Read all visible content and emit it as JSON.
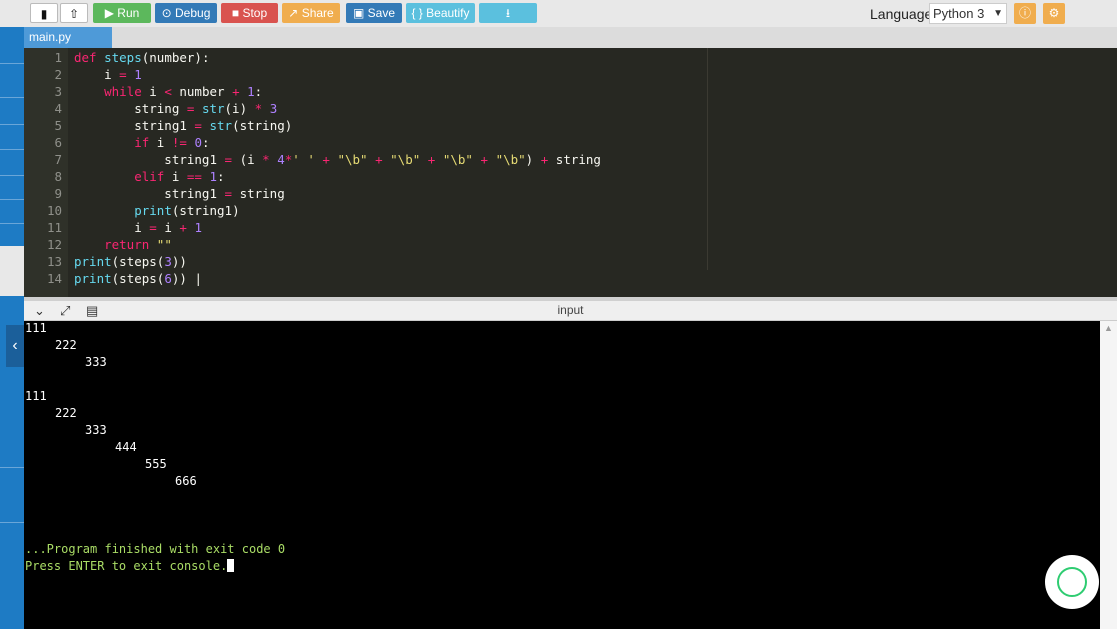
{
  "toolbar": {
    "run": "Run",
    "debug": "Debug",
    "stop": "Stop",
    "share": "Share",
    "save": "Save",
    "beautify": "{ } Beautify",
    "language_label": "Language",
    "language_value": "Python 3",
    "colors": {
      "run": "#5cb85c",
      "debug": "#337ab7",
      "stop": "#d9534f",
      "share": "#f0ad4e",
      "save": "#337ab7",
      "beautify": "#5bc0de",
      "download": "#5bc0de"
    }
  },
  "editor": {
    "tab": "main.py",
    "line_numbers": [
      "1",
      "2",
      "3",
      "4",
      "5",
      "6",
      "7",
      "8",
      "9",
      "10",
      "11",
      "12",
      "13",
      "14"
    ]
  },
  "console": {
    "title": "input",
    "output": [
      "111",
      "222",
      "333",
      "",
      "111",
      "222",
      "333",
      "444",
      "555",
      "666"
    ],
    "finished": "...Program finished with exit code 0",
    "press_enter": "Press ENTER to exit console."
  }
}
